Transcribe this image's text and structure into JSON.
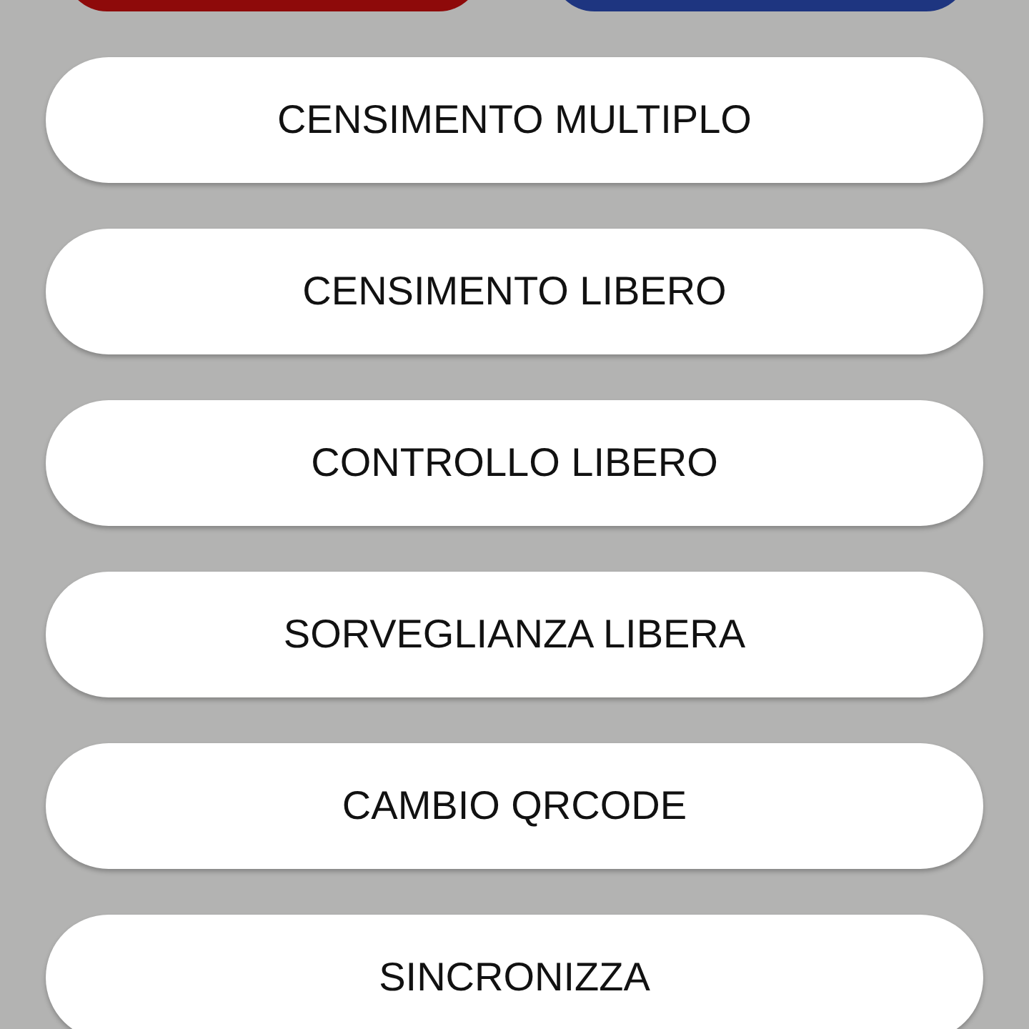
{
  "top_buttons": [
    {
      "color": "#8e0a0a"
    },
    {
      "color": "#1e3580"
    }
  ],
  "menu_buttons": [
    {
      "label": "CENSIMENTO MULTIPLO"
    },
    {
      "label": "CENSIMENTO LIBERO"
    },
    {
      "label": "CONTROLLO LIBERO"
    },
    {
      "label": "SORVEGLIANZA LIBERA"
    },
    {
      "label": "CAMBIO QRCODE"
    },
    {
      "label": "SINCRONIZZA"
    }
  ]
}
